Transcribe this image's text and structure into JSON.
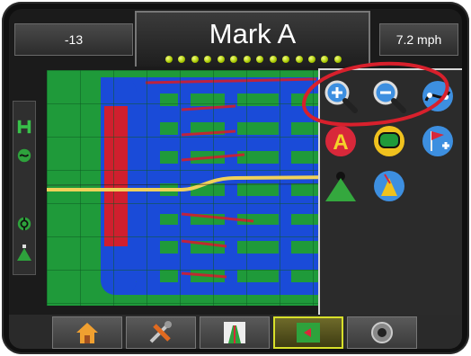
{
  "header": {
    "left_value": "-13",
    "title": "Mark A",
    "speed": "7.2 mph",
    "led_count": 14
  },
  "left_strip": {
    "icons": [
      "boom-section-icon",
      "steering-icon",
      "gps-status-icon",
      "nozzle-icon"
    ]
  },
  "panel": {
    "tools": [
      {
        "name": "zoom-in-icon"
      },
      {
        "name": "zoom-out-icon"
      },
      {
        "name": "curve-guideline-icon"
      },
      {
        "name": "mark-a-icon",
        "label": "A"
      },
      {
        "name": "boundary-icon"
      },
      {
        "name": "add-flag-icon"
      },
      {
        "name": "perspective-view-icon"
      },
      {
        "name": "compass-icon"
      }
    ]
  },
  "tabs": [
    {
      "name": "tab-home",
      "icon": "home-icon"
    },
    {
      "name": "tab-settings",
      "icon": "tools-icon"
    },
    {
      "name": "tab-guidance",
      "icon": "guidance-icon"
    },
    {
      "name": "tab-map",
      "icon": "map-icon",
      "active": true
    },
    {
      "name": "tab-camera",
      "icon": "camera-icon"
    }
  ],
  "colors": {
    "field": "#1f9a3a",
    "coverage": "#1a4bd8",
    "overlap": "#d01f2e",
    "guideline": "#f0d15a",
    "annotation": "#d8202c"
  }
}
